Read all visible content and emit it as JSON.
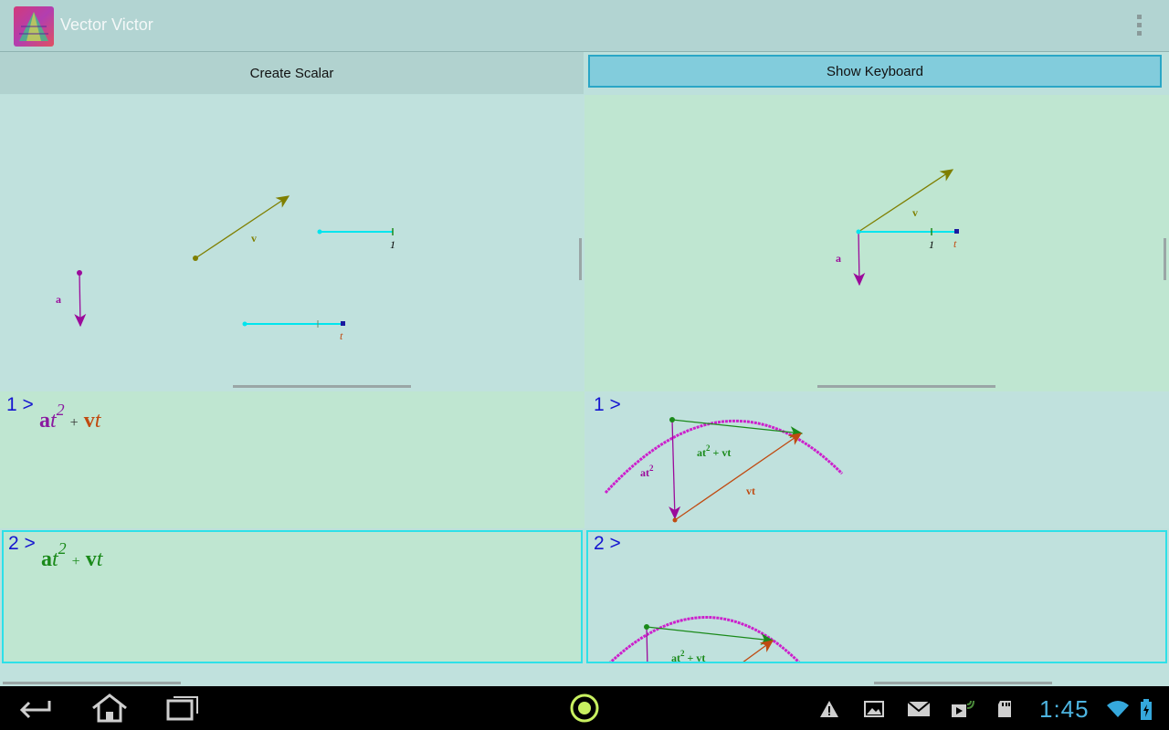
{
  "app": {
    "title": "Vector Victor",
    "icon": "app-logo-icon",
    "overflow_icon": "overflow-menu-icon"
  },
  "toolbar": {
    "create_scalar_label": "Create Scalar",
    "show_keyboard_label": "Show Keyboard"
  },
  "left_canvas": {
    "labels": {
      "v": "v",
      "a": "a",
      "one": "1",
      "t": "t"
    }
  },
  "right_canvas": {
    "labels": {
      "v": "v",
      "a": "a",
      "one": "1",
      "t": "t"
    }
  },
  "entries": [
    {
      "prompt": "1 >",
      "expr": {
        "a": "a",
        "t": "t",
        "exp": "2",
        "plus": "+",
        "v": "v",
        "t2": "t"
      },
      "graph": {
        "prompt": "1 >",
        "label_sum_a": "at",
        "label_sum_exp": "2",
        "label_sum_rest": " + vt",
        "label_at": "at",
        "label_at_exp": "2",
        "label_vt": "vt"
      }
    },
    {
      "prompt": "2 >",
      "expr": {
        "a": "a",
        "t": "t",
        "exp": "2",
        "plus": "+",
        "v": "v",
        "t2": "t"
      },
      "graph": {
        "prompt": "2 >",
        "label_sum_a": "at",
        "label_sum_exp": "2",
        "label_sum_rest": " + vt"
      }
    }
  ],
  "navbar": {
    "back_icon": "back-icon",
    "home_icon": "home-icon",
    "recents_icon": "recent-apps-icon",
    "center_icon": "record-indicator-icon",
    "status_icons": [
      "warning-icon",
      "image-icon",
      "gmail-icon",
      "play-store-icon",
      "sd-card-icon",
      "wifi-icon",
      "battery-icon"
    ],
    "clock": "1:45"
  },
  "colors": {
    "accent": "#2ee0e8",
    "vector_v": "#7f7f00",
    "vector_a": "#9b0a9b",
    "scalar": "#00e5ee",
    "sum": "#1a8a1a",
    "vt": "#c04a10",
    "parabola": "#cc20cc",
    "prompt": "#1515d0"
  }
}
